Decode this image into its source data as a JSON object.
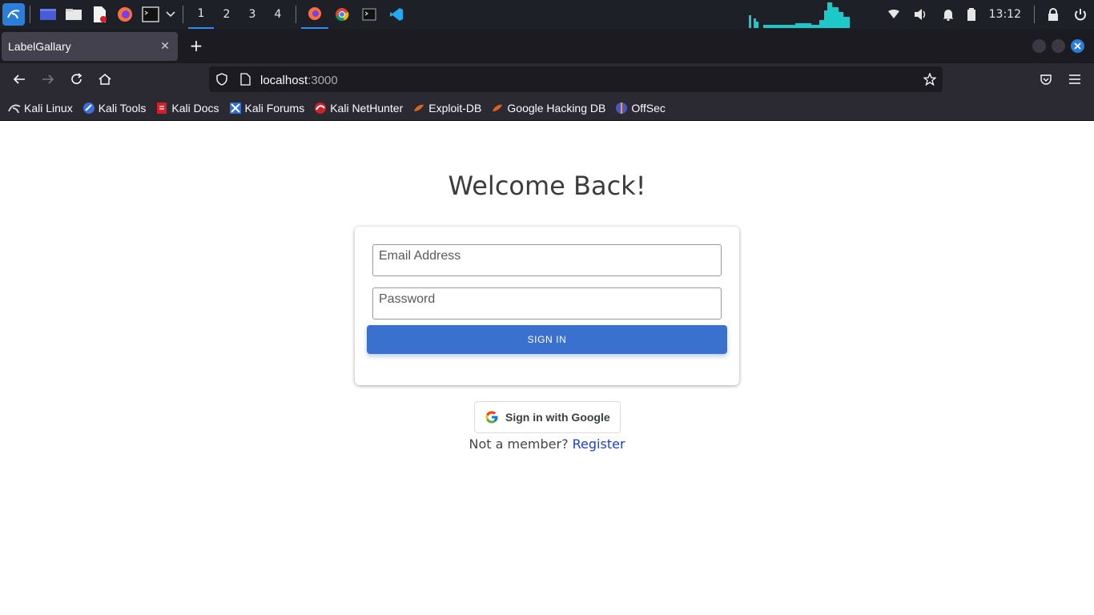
{
  "taskbar": {
    "workspaces": [
      "1",
      "2",
      "3",
      "4"
    ],
    "active_workspace": "1",
    "clock": "13:12"
  },
  "browser": {
    "tab_title": "LabelGallary",
    "url_host": "localhost",
    "url_port": ":3000",
    "bookmarks": [
      {
        "label": "Kali Linux",
        "icon": "kali-dragon-icon"
      },
      {
        "label": "Kali Tools",
        "icon": "kali-tools-icon"
      },
      {
        "label": "Kali Docs",
        "icon": "kali-docs-icon"
      },
      {
        "label": "Kali Forums",
        "icon": "kali-forums-icon"
      },
      {
        "label": "Kali NetHunter",
        "icon": "nethunter-icon"
      },
      {
        "label": "Exploit-DB",
        "icon": "exploit-db-icon"
      },
      {
        "label": "Google Hacking DB",
        "icon": "ghdb-icon"
      },
      {
        "label": "OffSec",
        "icon": "offsec-icon"
      }
    ]
  },
  "page": {
    "heading": "Welcome Back!",
    "email_placeholder": "Email Address",
    "password_placeholder": "Password",
    "signin_label": "SIGN IN",
    "google_label": "Sign in with Google",
    "member_prompt": "Not a member?",
    "register_label": "Register"
  },
  "colors": {
    "primary_button": "#3a71cf",
    "link": "#1a3fce",
    "taskbar_bg": "#1d2026"
  }
}
